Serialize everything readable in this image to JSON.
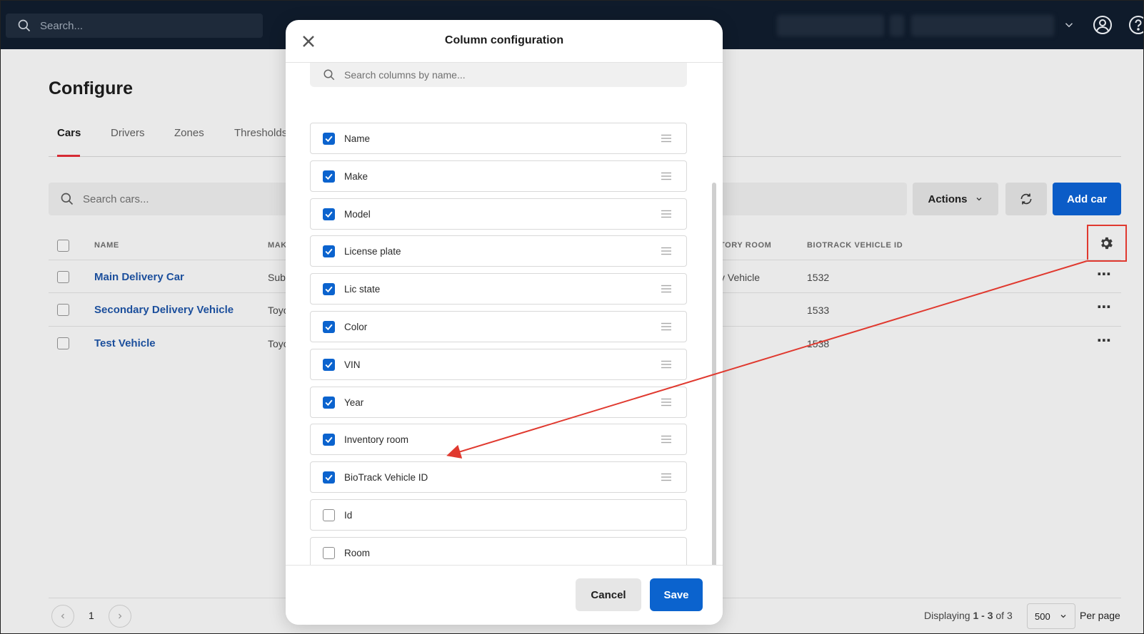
{
  "topbar": {
    "search_placeholder": "Search..."
  },
  "page": {
    "title": "Configure",
    "tabs": [
      "Cars",
      "Drivers",
      "Zones",
      "Thresholds"
    ],
    "active_tab": "Cars"
  },
  "toolbar": {
    "search_placeholder": "Search cars...",
    "actions_label": "Actions",
    "add_label": "Add car"
  },
  "table": {
    "headers": [
      "NAME",
      "MAK",
      "TORY ROOM",
      "BIOTRACK VEHICLE ID"
    ],
    "rows": [
      {
        "name": "Main Delivery Car",
        "make": "Sub",
        "inventory_room": "y Vehicle",
        "biotrack_id": "1532"
      },
      {
        "name": "Secondary Delivery Vehicle",
        "make": "Toyo",
        "inventory_room": "",
        "biotrack_id": "1533"
      },
      {
        "name": "Test Vehicle",
        "make": "Toyo",
        "inventory_room": "",
        "biotrack_id": "1538"
      }
    ]
  },
  "pagination": {
    "current_page": "1",
    "displaying_prefix": "Displaying ",
    "displaying_range": "1 - 3",
    "displaying_of": " of ",
    "displaying_total": "3",
    "per_page_value": "500",
    "per_page_label": "Per page"
  },
  "modal": {
    "title": "Column configuration",
    "search_placeholder": "Search columns by name...",
    "columns": [
      {
        "label": "Name",
        "checked": true
      },
      {
        "label": "Make",
        "checked": true
      },
      {
        "label": "Model",
        "checked": true
      },
      {
        "label": "License plate",
        "checked": true
      },
      {
        "label": "Lic state",
        "checked": true
      },
      {
        "label": "Color",
        "checked": true
      },
      {
        "label": "VIN",
        "checked": true
      },
      {
        "label": "Year",
        "checked": true
      },
      {
        "label": "Inventory room",
        "checked": true
      },
      {
        "label": "BioTrack Vehicle ID",
        "checked": true
      },
      {
        "label": "Id",
        "checked": false
      },
      {
        "label": "Room",
        "checked": false
      }
    ],
    "cancel_label": "Cancel",
    "save_label": "Save"
  },
  "colors": {
    "topbar": "#0f1b2b",
    "primary": "#0b63ce",
    "link": "#1c4f9c",
    "active_tab_underline": "#d62b34",
    "annotation": "#e0392f"
  }
}
